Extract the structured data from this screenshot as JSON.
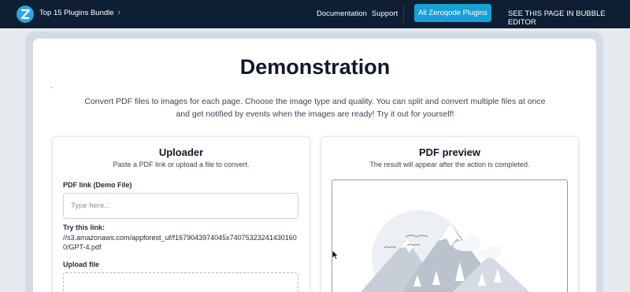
{
  "nav": {
    "brand": "Top 15 Plugins Bundle",
    "links": {
      "documentation": "Documentation",
      "support": "Support",
      "all_plugins": "All Zeroqode Plugins",
      "editor": "SEE THIS PAGE IN BUBBLE EDITOR"
    }
  },
  "page": {
    "title": "Demonstration",
    "description": "Convert PDF files to images for each page. Choose the image type and quality. You can split and convert multiple files at once and get notified by events when the images are ready! Try it out for yourself!"
  },
  "uploader": {
    "title": "Uploader",
    "subtitle": "Paste a PDF link or upload a file to convert.",
    "link_label": "PDF link (Demo File)",
    "link_placeholder": "Type here...",
    "link_value": "",
    "try_label": "Try this link:",
    "try_url": "//s3.amazonaws.com/appforest_uf/f1679043974045x740753232414301600/GPT-4.pdf",
    "upload_label": "Upload file"
  },
  "preview": {
    "title": "PDF preview",
    "subtitle": "The result will appear after the action is completed."
  },
  "colors": {
    "nav_bg": "#0e1e33",
    "accent": "#17a0d6",
    "frame": "#d3dbe4"
  },
  "icons": {
    "logo": "zeroqode-logo",
    "brand_arrow": "chevron-right-icon",
    "preview_placeholder": "mountain-landscape-illustration",
    "cursor": "mouse-pointer-icon"
  }
}
